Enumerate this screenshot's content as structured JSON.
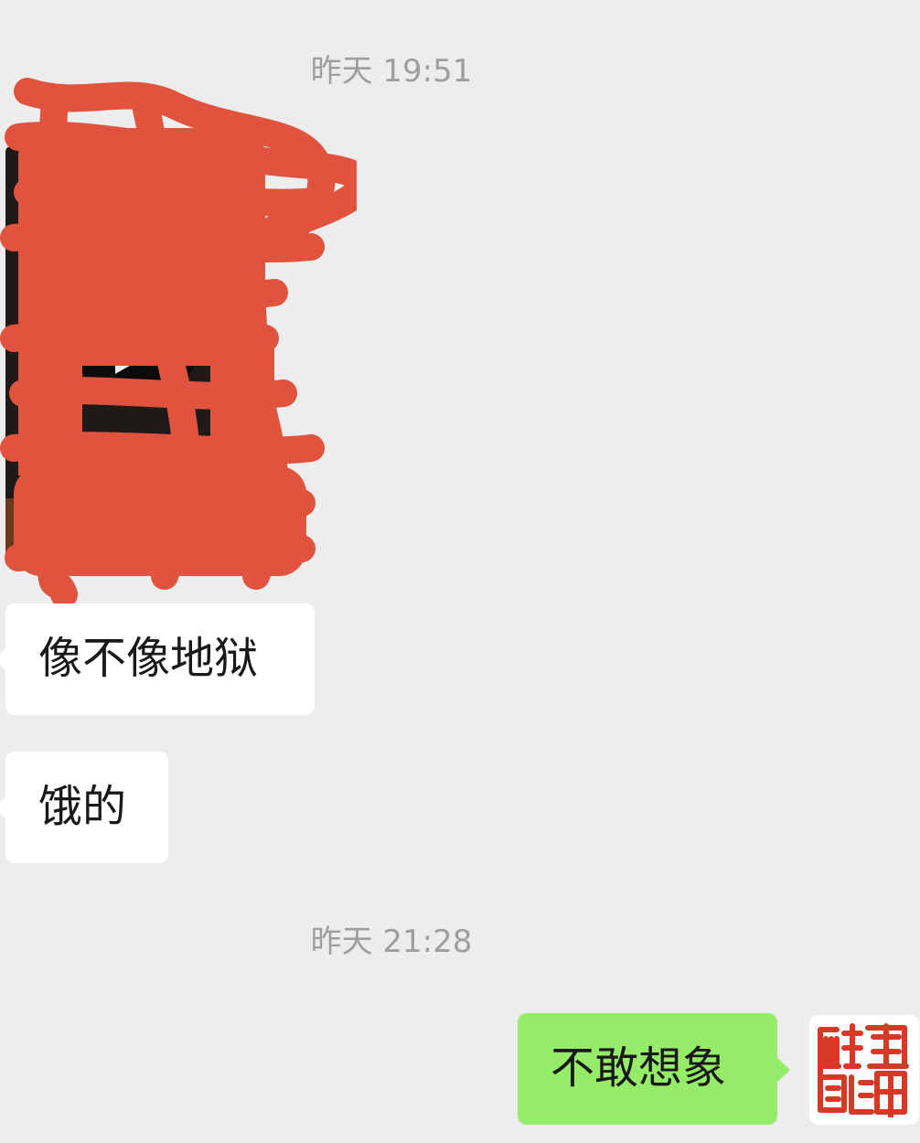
{
  "chat": {
    "timestamps": [
      "昨天 19:51",
      "昨天 21:28"
    ],
    "messages": [
      {
        "from": "other",
        "type": "video"
      },
      {
        "from": "other",
        "type": "text",
        "text": "像不像地狱"
      },
      {
        "from": "other",
        "type": "text",
        "text": "饿的"
      },
      {
        "from": "self",
        "type": "text",
        "text": "不敢想象"
      }
    ]
  },
  "icons": {
    "play": "play-icon",
    "avatar": "seal-avatar-icon"
  },
  "colors": {
    "background": "#ededed",
    "incoming_bubble": "#ffffff",
    "outgoing_bubble": "#95ec69",
    "timestamp_text": "#9e9e9e",
    "redaction": "#e0533f",
    "seal": "#d63a26"
  }
}
